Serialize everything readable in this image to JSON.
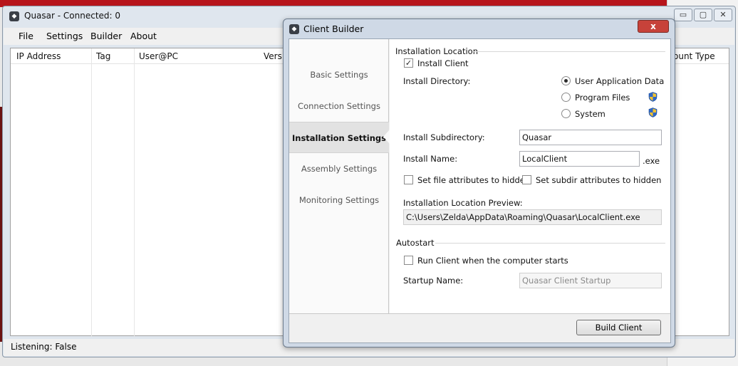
{
  "main_window": {
    "title": "Quasar - Connected: 0",
    "menu": [
      "File",
      "Settings",
      "Builder",
      "About"
    ],
    "columns": [
      "IP Address",
      "Tag",
      "User@PC",
      "Versio",
      "ount Type"
    ],
    "status": "Listening: False",
    "controls": {
      "minimize": "▭",
      "maximize": "▢",
      "close": "✕"
    }
  },
  "builder": {
    "title": "Client Builder",
    "close_label": "x",
    "sidebar": [
      "Basic Settings",
      "Connection Settings",
      "Installation Settings",
      "Assembly Settings",
      "Monitoring Settings"
    ],
    "active_section": "Installation Settings",
    "installation": {
      "group_label": "Installation Location",
      "install_client_label": "Install Client",
      "install_client_checked": true,
      "install_directory_label": "Install Directory:",
      "directory_options": [
        "User Application Data",
        "Program Files",
        "System"
      ],
      "selected_directory": "User Application Data",
      "subdirectory_label": "Install Subdirectory:",
      "subdirectory_value": "Quasar",
      "install_name_label": "Install Name:",
      "install_name_value": "LocalClient",
      "exe_suffix": ".exe",
      "hidden_file_label": "Set file attributes to hidden",
      "hidden_subdir_label": "Set subdir attributes to hidden",
      "preview_label": "Installation Location Preview:",
      "preview_value": "C:\\Users\\Zelda\\AppData\\Roaming\\Quasar\\LocalClient.exe"
    },
    "autostart": {
      "group_label": "Autostart",
      "run_on_start_label": "Run Client when the computer starts",
      "startup_name_label": "Startup Name:",
      "startup_name_placeholder": "Quasar Client Startup"
    },
    "build_button": "Build Client"
  },
  "colors": {
    "background_strip": "#b7151b",
    "close_button": "#c7423a",
    "window_frame": "#cfd9e6"
  }
}
